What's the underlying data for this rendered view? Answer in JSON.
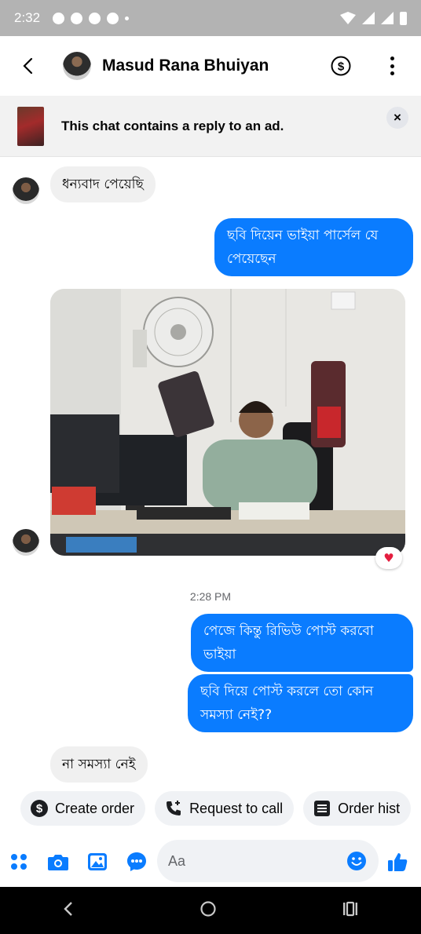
{
  "status_bar": {
    "time": "2:32",
    "signal_icon": "signal-icon",
    "wifi_icon": "wifi-icon",
    "battery_icon": "battery-icon"
  },
  "header": {
    "contact_name": "Masud Rana Bhuiyan",
    "back_icon": "back-arrow-icon",
    "payment_icon": "dollar-icon",
    "more_icon": "more-vertical-icon"
  },
  "ad_banner": {
    "text": "This chat contains a reply to an ad.",
    "close_label": "×"
  },
  "messages": [
    {
      "from": "contact",
      "text": "ধন্যবাদ পেয়েছি"
    },
    {
      "from": "me",
      "text": "ছবি দিয়েন ভাইয়া পার্সেল যে পেয়েছেন"
    },
    {
      "from": "contact",
      "type": "photo",
      "reaction": "♥"
    },
    {
      "from": "me",
      "text": "পেজে কিন্তু রিভিউ পোস্ট করবো ভাইয়া"
    },
    {
      "from": "me",
      "text": "ছবি দিয়ে পোস্ট করলে তো কোন সমস্যা নেই??"
    },
    {
      "from": "contact",
      "text": "না সমস্যা নেই"
    }
  ],
  "timestamp": "2:28 PM",
  "quick_actions": [
    {
      "label": "Create order",
      "icon": "dollar-circle-icon"
    },
    {
      "label": "Request to call",
      "icon": "phone-plus-icon"
    },
    {
      "label": "Order hist",
      "icon": "list-icon"
    }
  ],
  "composer": {
    "placeholder": "Aa"
  },
  "colors": {
    "accent": "#0a7cff",
    "incoming_bubble": "#f0f0f0",
    "reaction_heart": "#e41e3f"
  }
}
